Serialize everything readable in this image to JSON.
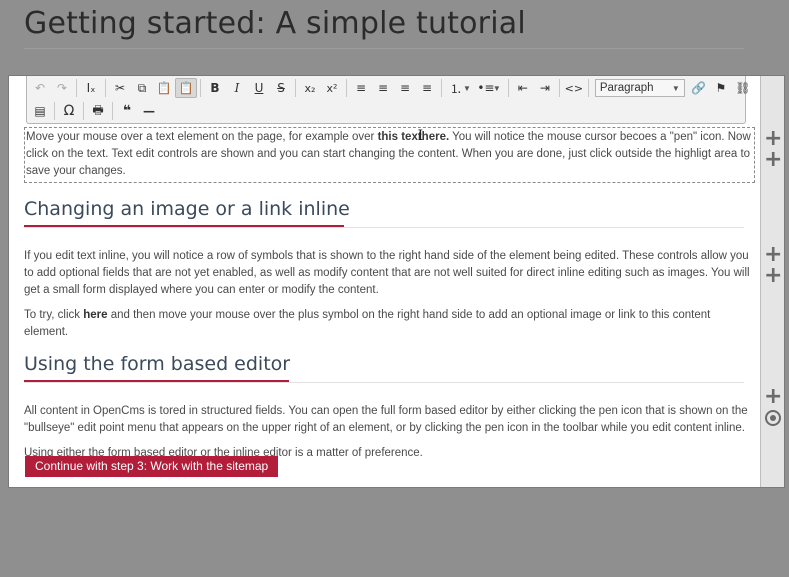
{
  "page": {
    "title": "Getting started: A simple tutorial"
  },
  "toolbar": {
    "format_combo_value": "Paragraph",
    "buttons": {
      "undo": "↶",
      "redo": "↷",
      "remove_format": "Iₓ",
      "cut": "✂",
      "copy": "⧉",
      "paste": "📋",
      "paste_text": "📋",
      "bold": "B",
      "italic": "I",
      "underline": "U",
      "strike": "S",
      "subscript": "x₂",
      "superscript": "x²",
      "align_left": "≡",
      "align_center": "≡",
      "align_right": "≡",
      "align_justify": "≡",
      "numbered_list": "⒈",
      "bullet_list": "•≡",
      "outdent": "⇤",
      "indent": "⇥",
      "source": "<>",
      "link": "🔗",
      "anchor": "⚑",
      "unlink": "⛓",
      "template": "▤",
      "special_char": "Ω",
      "print": "🖶",
      "blockquote": "❝",
      "hr": "—"
    }
  },
  "content": {
    "edit_area": {
      "text_before": "Move your mouse over a text element on the page, for example over ",
      "bold_a": "this text",
      "bold_b": "here.",
      "text_after": " You will notice the mouse cursor becoes a \"pen\" icon. Now click on the text. Text edit controls are shown and you can start changing the content. When you are done, just click outside the highligt area to save your changes."
    },
    "section1": {
      "heading": "Changing an image or a link inline",
      "para1": "If you edit text inline, you will notice a row of symbols that is shown to the right hand side of the element being edited. These controls allow you to add optional fields that are not yet enabled, as well as modify content that are not well suited for direct inline editing such as images. You will get a small form displayed where you can enter or modify the content.",
      "para2_before": "To try, click ",
      "para2_bold": "here",
      "para2_after": " and then move your mouse over the plus symbol on the right hand side to add an optional image or link to this content element."
    },
    "section2": {
      "heading": "Using the form based editor",
      "para1": "All content in OpenCms is tored in structured fields. You can open the full form based editor by either clicking the pen icon that is shown on the \"bullseye\" edit point menu that appears on the upper right of an element, or by clicking the pen icon in the toolbar while you edit content inline.",
      "para2": "Using either the form based editor or the inline editor is a matter of preference."
    },
    "cta_label": "Continue with step 3: Work with the sitemap"
  },
  "rail": {
    "plus": "+"
  }
}
